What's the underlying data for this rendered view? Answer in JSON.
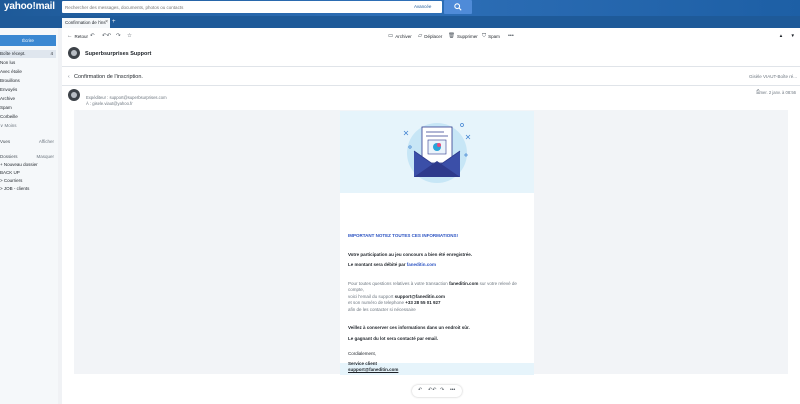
{
  "app": {
    "logo": "yahoo!mail",
    "search_placeholder": "Rechercher des messages, documents, photos ou contacts",
    "search_advanced": "Avancée"
  },
  "tabs": [
    {
      "label": "Confirmation de l'ins",
      "close": "×"
    }
  ],
  "tab_add": "+",
  "sidebar": {
    "compose": "Écrire",
    "items": [
      {
        "label": "Boîte récept.",
        "count": "4",
        "active": true
      },
      {
        "label": "Non lus"
      },
      {
        "label": "Avec étoile"
      },
      {
        "label": "Brouillons"
      },
      {
        "label": "Envoyés"
      },
      {
        "label": "Archive"
      },
      {
        "label": "Spam"
      },
      {
        "label": "Corbeille"
      },
      {
        "label": "∨ Moins"
      }
    ],
    "views_head": "Vues",
    "views_action": "Afficher",
    "folders_head": "Dossiers",
    "folders_action": "Masquer",
    "folders": [
      {
        "label": "+ Nouveau dossier"
      },
      {
        "label": "BACK UP"
      },
      {
        "label": "> Courriers"
      },
      {
        "label": "> JOB - clients"
      }
    ]
  },
  "toolbar": {
    "back": "Retour",
    "archive": "Archiver",
    "move": "Déplacer",
    "delete": "Supprimer",
    "spam": "Spam",
    "more": "•••"
  },
  "message": {
    "sender_name": "Superbsurprises Support",
    "subject": "Confirmation de l'inscription.",
    "subject_right": "Gisèle VIAUT-Boîte ré...",
    "from": "Expéditeur : support@superbsurprises.com",
    "to": "À : gisele.viaut@yahoo.fr",
    "date": "mer. 2 janv. à 08:56"
  },
  "email": {
    "heading": "IMPORTANT NOTEZ TOUTES CES INFORMATIONS!",
    "line1": "Votre participation au jeu concours a bien été enregistrée.",
    "line2_prefix": "Le montant sera débité par ",
    "line2_link": "faneditin.com",
    "q1_prefix": "Pour toutes questions relatives à votre transaction ",
    "q1_bold": "faneditin.com",
    "q1_suffix": " sur votre relevé de compte,",
    "q2_prefix": "voici l'email du support ",
    "q2_bold": "support@faneditin.com",
    "q3_prefix": "et son numéro de telephone ",
    "q3_bold": "+33 28 55 01 927",
    "q4": "afin de les contacter si nécessaire",
    "keep": "Veillez à conserver ces informations dans un endroit sûr.",
    "winner": "Le gagnant du lot sera contacté par email.",
    "regards": "Cordialement,",
    "service": "Service client",
    "support_link": "support@faneditin.com"
  },
  "colors": {
    "topbar": "#1e5a99",
    "compose": "#3a88d2",
    "heading_blue": "#2a52c2",
    "banner_bg": "#e6f4fb"
  }
}
